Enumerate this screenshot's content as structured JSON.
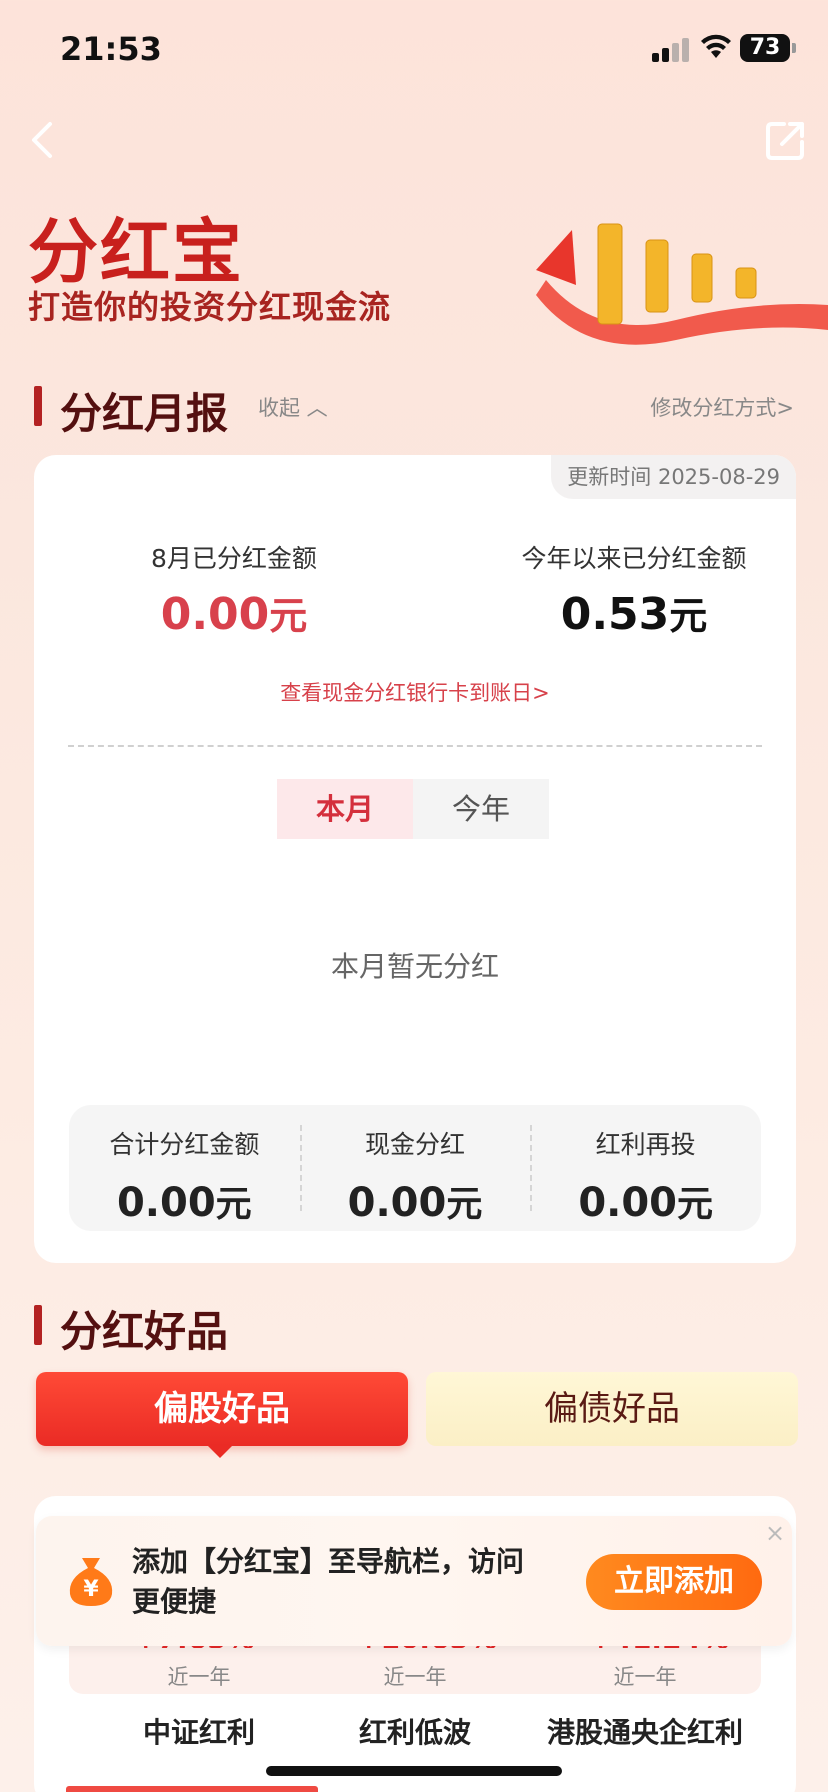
{
  "status_bar": {
    "time": "21:53",
    "battery": "73"
  },
  "header": {
    "title": "分红宝",
    "subtitle": "打造你的投资分红现金流",
    "back_icon": "chevron-left-icon",
    "share_icon": "share-icon"
  },
  "monthly_report": {
    "title": "分红月报",
    "collapse_label": "收起 ︿",
    "modify_label": "修改分红方式>",
    "update_time": "更新时间 2025-08-29",
    "month_label": "8月已分红金额",
    "month_value": "0.00",
    "year_label": "今年以来已分红金额",
    "year_value": "0.53",
    "unit": "元",
    "bank_link": "查看现金分红银行卡到账日>",
    "tabs": [
      "本月",
      "今年"
    ],
    "empty_text": "本月暂无分红",
    "summary": [
      {
        "label": "合计分红金额",
        "value": "0.00"
      },
      {
        "label": "现金分红",
        "value": "0.00"
      },
      {
        "label": "红利再投",
        "value": "0.00"
      }
    ]
  },
  "good_products": {
    "title": "分红好品",
    "tabs": [
      "偏股好品",
      "偏债好品"
    ],
    "funds": [
      {
        "return": "+7.65%",
        "period": "近一年",
        "name": "中证红利"
      },
      {
        "return": "+10.65%",
        "period": "近一年",
        "name": "红利低波"
      },
      {
        "return": "+41.24%",
        "period": "近一年",
        "name": "港股通央企红利"
      }
    ]
  },
  "promo": {
    "text": "添加【分红宝】至导航栏，访问更便捷",
    "button": "立即添加",
    "close": "×"
  },
  "colors": {
    "accent_red": "#d42f3c",
    "title_red": "#c8201d",
    "orange": "#ff7a18"
  }
}
